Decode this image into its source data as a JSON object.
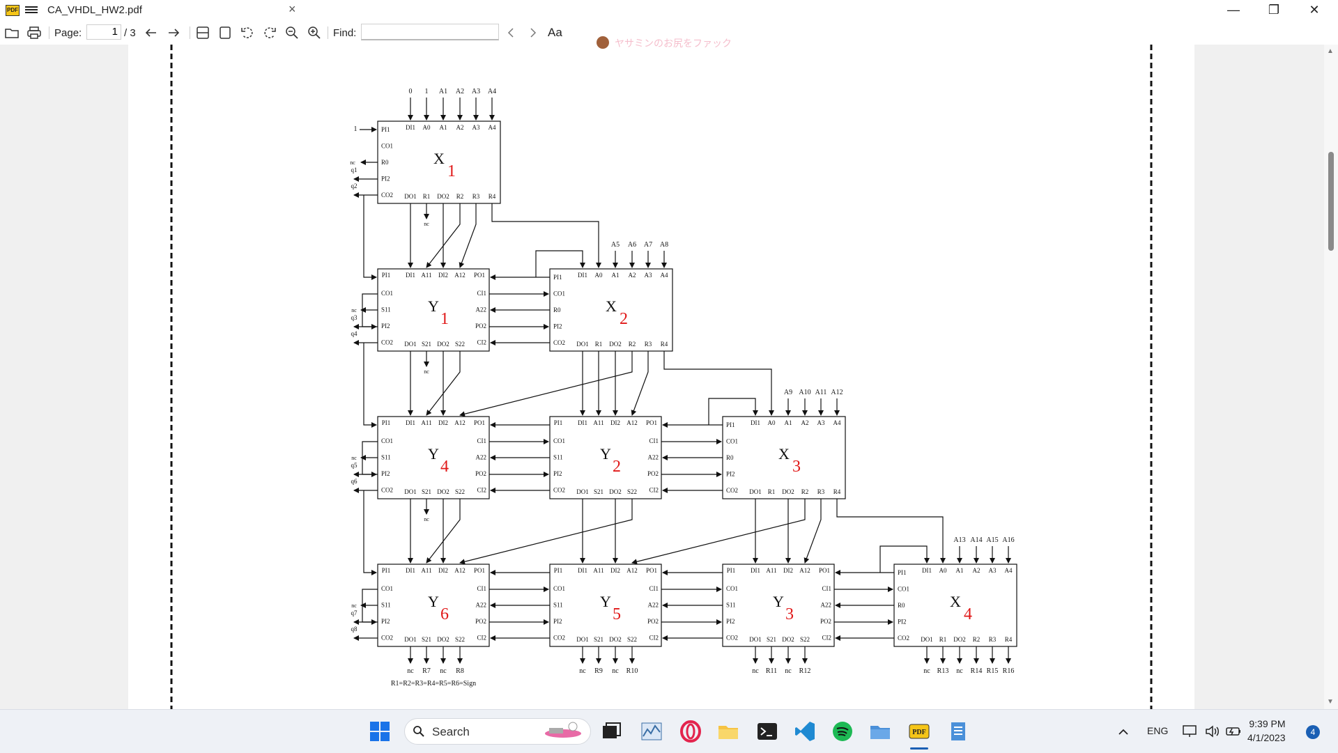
{
  "window": {
    "title": "CA_VHDL_HW2.pdf",
    "tab_close": "×",
    "minimize": "—",
    "maximize": "❐",
    "close": "✕"
  },
  "toolbar": {
    "page_label": "Page:",
    "page_value": "1",
    "page_total": "/ 3",
    "find_label": "Find:",
    "text_tool": "Aa"
  },
  "watermark": {
    "text": "ヤサミンのお尻をファック"
  },
  "diagram": {
    "top_inputs_x1": [
      "0",
      "1",
      "A1",
      "A2",
      "A3",
      "A4"
    ],
    "top_inputs_x2": [
      "A5",
      "A6",
      "A7",
      "A8"
    ],
    "top_inputs_x3": [
      "A9",
      "A10",
      "A11",
      "A12"
    ],
    "top_inputs_x4": [
      "A13",
      "A14",
      "A15",
      "A16"
    ],
    "x_ports_top": [
      "DI1",
      "A0",
      "A1",
      "A2",
      "A3",
      "A4"
    ],
    "x_ports_left": [
      "PI1",
      "CO1",
      "R0",
      "PI2",
      "CO2"
    ],
    "x_ports_bottom": [
      "DO1",
      "R1",
      "DO2",
      "R2",
      "R3",
      "R4"
    ],
    "y_ports_top": [
      "PI1",
      "DI1",
      "A11",
      "DI2",
      "A12",
      "PO1"
    ],
    "y_ports_left": [
      "CO1",
      "S11",
      "PI2",
      "CO2"
    ],
    "y_ports_right": [
      "CI1",
      "A22",
      "PO2",
      "CI2"
    ],
    "y_ports_bottom": [
      "DO1",
      "S21",
      "DO2",
      "S22"
    ],
    "blocks": [
      {
        "name": "X",
        "num": "1"
      },
      {
        "name": "Y",
        "num": "1"
      },
      {
        "name": "X",
        "num": "2"
      },
      {
        "name": "Y",
        "num": "4"
      },
      {
        "name": "Y",
        "num": "2"
      },
      {
        "name": "X",
        "num": "3"
      },
      {
        "name": "Y",
        "num": "6"
      },
      {
        "name": "Y",
        "num": "5"
      },
      {
        "name": "Y",
        "num": "3"
      },
      {
        "name": "X",
        "num": "4"
      }
    ],
    "side_outputs": [
      "q1",
      "q2",
      "q3",
      "q4",
      "q5",
      "q6",
      "q7",
      "q8"
    ],
    "one_label": "1",
    "nc": "nc",
    "outputs_y6": [
      "nc",
      "R7",
      "nc",
      "R8"
    ],
    "outputs_y5": [
      "nc",
      "R9",
      "nc",
      "R10"
    ],
    "outputs_y3": [
      "nc",
      "R11",
      "nc",
      "R12"
    ],
    "outputs_x4": [
      "nc",
      "R13",
      "nc",
      "R14",
      "R15",
      "R16"
    ],
    "footnote": "R1=R2=R3=R4=R5=R6=Sign"
  },
  "taskbar": {
    "search_label": "Search",
    "lang": "ENG",
    "time": "9:39 PM",
    "date": "4/1/2023",
    "notifications": "4"
  }
}
